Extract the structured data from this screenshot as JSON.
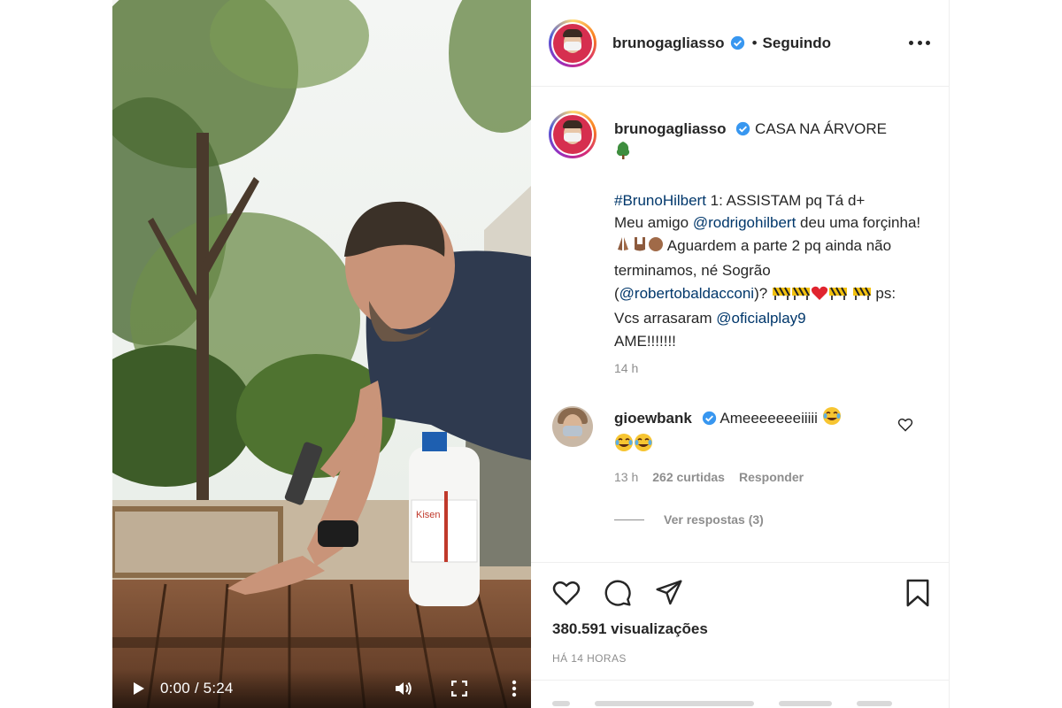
{
  "video": {
    "current_time": "0:00",
    "separator": " / ",
    "duration": "5:24",
    "icons": [
      "play-icon",
      "volume-icon",
      "fullscreen-icon",
      "more-vertical-icon"
    ],
    "bottle_label": "Kisen"
  },
  "header": {
    "username": "brunogagliasso",
    "dot": "•",
    "follow_status": "Seguindo"
  },
  "caption": {
    "username": "brunogagliasso",
    "title": "CASA NA ÁRVORE",
    "hashtag": "#BrunoHilbert",
    "line1_rest": " 1: ASSISTAM pq Tá d+",
    "line2_start": "Meu amigo ",
    "mention1": "@rodrigohilbert",
    "line2_end": " deu uma forçinha!",
    "line3": " Aguardem a parte 2 pq ainda não terminamos, né Sogrão (",
    "mention2": "@robertobaldacconi",
    "line4": ")? ",
    "line5": " ps: Vcs arrasaram ",
    "mention3": "@oficialplay9",
    "line6": "AME!!!!!!!",
    "time": "14 h"
  },
  "comment": {
    "username": "gioewbank",
    "text": "Ameeeeeeeiiiii",
    "time": "13 h",
    "likes": "262 curtidas",
    "reply": "Responder",
    "view_replies": "Ver respostas (3)"
  },
  "actions": {
    "views": "380.591 visualizações",
    "posted": "HÁ 14 HORAS"
  },
  "colors": {
    "link": "#00376b",
    "verified": "#3897f0",
    "secondary_text": "#8e8e8e",
    "heart": "#ed4956"
  }
}
